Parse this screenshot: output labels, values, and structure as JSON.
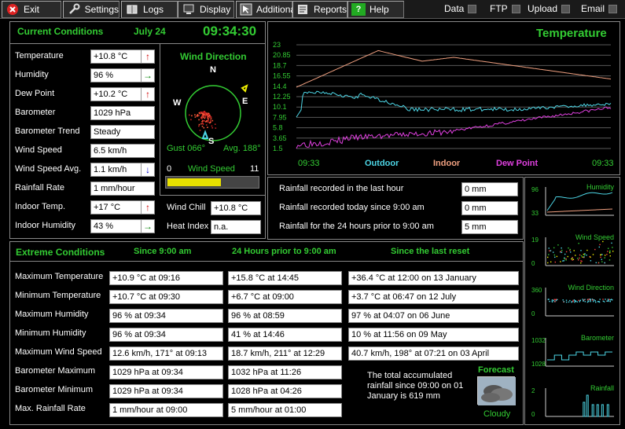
{
  "toolbar": {
    "exit": "Exit",
    "settings": "Settings",
    "logs": "Logs",
    "display": "Display",
    "additional": "Additional",
    "reports": "Reports",
    "help": "Help"
  },
  "indicators": {
    "data": "Data",
    "ftp": "FTP",
    "upload": "Upload",
    "email": "Email"
  },
  "current": {
    "title": "Current Conditions",
    "date": "July 24",
    "time": "09:34:30",
    "rows": [
      {
        "label": "Temperature",
        "value": "+10.8 °C"
      },
      {
        "label": "Humidity",
        "value": "96 %"
      },
      {
        "label": "Dew Point",
        "value": "+10.2 °C"
      },
      {
        "label": "Barometer",
        "value": "1029 hPa"
      },
      {
        "label": "Barometer Trend",
        "value": "Steady"
      },
      {
        "label": "Wind Speed",
        "value": "6.5 km/h"
      },
      {
        "label": "Wind Speed Avg.",
        "value": "1.1 km/h"
      },
      {
        "label": "Rainfall Rate",
        "value": "1 mm/hour"
      },
      {
        "label": "Indoor Temp.",
        "value": "+17 °C"
      },
      {
        "label": "Indoor Humidity",
        "value": "43 %"
      }
    ],
    "trend_colors": {
      "up": "#d00000",
      "steady": "#008000",
      "down": "#0000cc"
    }
  },
  "wind": {
    "title": "Wind Direction",
    "north": "N",
    "east": "E",
    "south": "S",
    "west": "W",
    "gust": "Gust 066°",
    "avg": "Avg. 188°",
    "speed_label": "Wind Speed",
    "speed_min": "0",
    "speed_max": "11",
    "speed_fraction": 0.59
  },
  "chill": {
    "wind_chill_label": "Wind Chill",
    "wind_chill": "+10.8 °C",
    "heat_index_label": "Heat Index",
    "heat_index": "n.a."
  },
  "rainfall": [
    {
      "label": "Rainfall recorded in the last hour",
      "value": "0 mm"
    },
    {
      "label": "Rainfall recorded today since 9:00 am",
      "value": "0 mm"
    },
    {
      "label": "Rainfall for the 24 hours prior to 9:00 am",
      "value": "5 mm"
    }
  ],
  "temp_chart": {
    "title": "Temperature",
    "yticks": [
      "23",
      "20.85",
      "18.7",
      "16.55",
      "14.4",
      "12.25",
      "10.1",
      "7.95",
      "5.8",
      "3.65",
      "1.5"
    ],
    "x_start": "09:33",
    "x_end": "09:33",
    "legend": [
      {
        "name": "Outdoor",
        "color": "#4dd6e6"
      },
      {
        "name": "Indoor",
        "color": "#f0a080"
      },
      {
        "name": "Dew Point",
        "color": "#e040e0"
      }
    ]
  },
  "mini": [
    {
      "title": "Humidity",
      "ymax": "96",
      "ymin": "33"
    },
    {
      "title": "Wind Speed",
      "ymax": "19",
      "ymin": "0"
    },
    {
      "title": "Wind Direction",
      "ymax": "360",
      "ymin": "0"
    },
    {
      "title": "Barometer",
      "ymax": "1032",
      "ymin": "1028"
    },
    {
      "title": "Rainfall",
      "ymax": "2",
      "ymin": "0"
    }
  ],
  "extremes": {
    "title": "Extreme Conditions",
    "col1": "Since 9:00 am",
    "col2": "24 Hours prior to 9:00 am",
    "col3": "Since the last reset",
    "rows": [
      {
        "label": "Maximum Temperature",
        "a": "+10.9 °C at 09:16",
        "b": "+15.8 °C at 14:45",
        "c": "+36.4 °C at 12:00 on 13 January"
      },
      {
        "label": "Minimum Temperature",
        "a": "+10.7 °C at 09:30",
        "b": "+6.7 °C at 09:00",
        "c": "+3.7 °C at 06:47 on 12 July"
      },
      {
        "label": "Maximum Humidity",
        "a": "96 % at 09:34",
        "b": "96 % at 08:59",
        "c": "97 % at 04:07 on 06 June"
      },
      {
        "label": "Minimum Humidity",
        "a": "96 % at 09:34",
        "b": "41 % at 14:46",
        "c": "10 % at 11:56 on 09 May"
      },
      {
        "label": "Maximum Wind Speed",
        "a": "12.6 km/h, 171° at 09:13",
        "b": "18.7 km/h, 211° at 12:29",
        "c": "40.7 km/h, 198° at 07:21 on 03 April"
      },
      {
        "label": "Barometer Maximum",
        "a": "1029 hPa at 09:34",
        "b": "1032 hPa at 11:26"
      },
      {
        "label": "Barometer Minimum",
        "a": "1029 hPa at 09:34",
        "b": "1028 hPa at 04:26"
      },
      {
        "label": "Max. Rainfall Rate",
        "a": "1 mm/hour at 09:00",
        "b": "5 mm/hour at 01:00"
      }
    ],
    "accum_text": "The total accumulated rainfall since 09:00 on 01 January is 619 mm"
  },
  "forecast": {
    "title": "Forecast",
    "value": "Cloudy"
  }
}
